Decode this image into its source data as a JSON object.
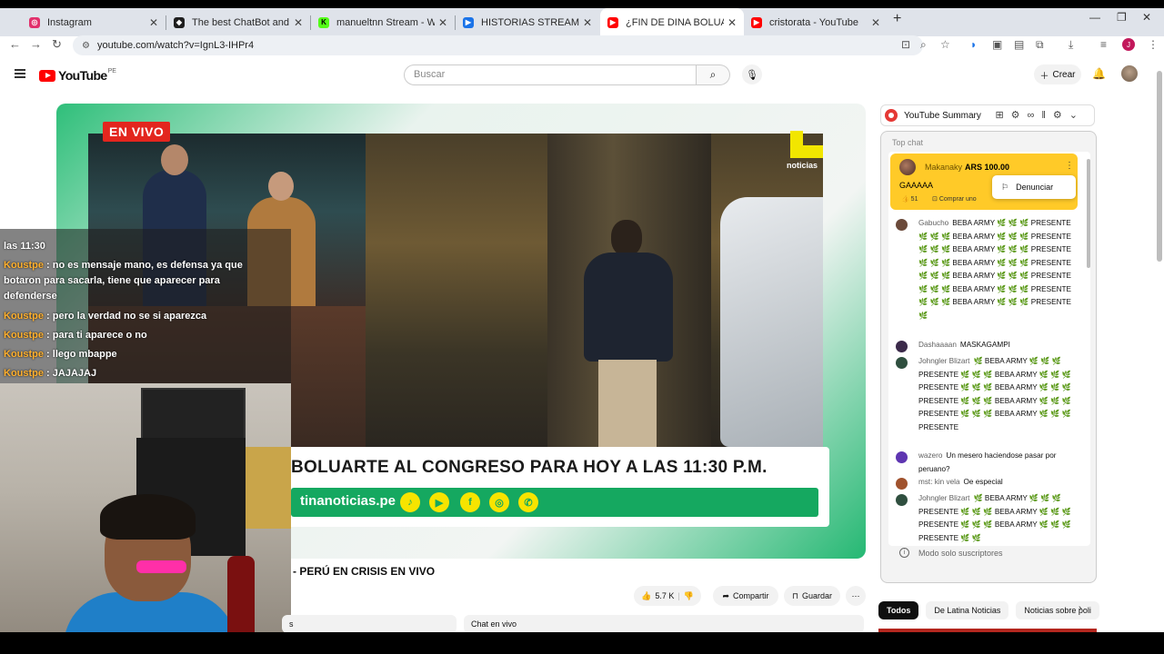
{
  "tabs": [
    {
      "label": "Instagram",
      "icon": "instagram-icon",
      "color": "#e1306c"
    },
    {
      "label": "The best ChatBot and Widgets",
      "icon": "streamelements-icon",
      "color": "#1f1f1f"
    },
    {
      "label": "manueltnn Stream - Watch Live",
      "icon": "kick-icon",
      "color": "#53fc18"
    },
    {
      "label": "HISTORIAS STREAM - Tu histor",
      "icon": "meet-icon",
      "color": "#1a73e8"
    },
    {
      "label": "¿FIN DE DINA BOLUARTE? - PE",
      "icon": "youtube-icon",
      "color": "#ff0000"
    },
    {
      "label": "cristorata - YouTube",
      "icon": "youtube-icon",
      "color": "#ff0000"
    }
  ],
  "browser": {
    "url": "youtube.com/watch?v=IgnL3-IHPr4",
    "new_tab": "+",
    "profile_initial": "J"
  },
  "youtube": {
    "logo_text": "YouTube",
    "country": "PE",
    "search_placeholder": "Buscar",
    "create_label": "Crear"
  },
  "player": {
    "live_badge": "EN VIVO",
    "brand_text": "noticias",
    "headline": "BOLUARTE AL CONGRESO PARA HOY A LAS 11:30 P.M.",
    "site": "tinanoticias.pe"
  },
  "overlay_chat": [
    {
      "user": "",
      "text": "las 11:30"
    },
    {
      "user": "Koustpe",
      "text": "no es mensaje mano, es defensa ya que botaron para sacarla, tiene que aparecer para defenderse"
    },
    {
      "user": "Koustpe",
      "text": "pero la verdad no se si aparezca"
    },
    {
      "user": "Koustpe",
      "text": "para ti aparece o no"
    },
    {
      "user": "Koustpe",
      "text": "llego mbappe"
    },
    {
      "user": "Koustpe",
      "text": "JAJAJAJ"
    }
  ],
  "video": {
    "title": "- PERÚ EN CRISIS EN VIVO",
    "likes": "5.7 K",
    "share": "Compartir",
    "save": "Guardar",
    "chat_tab": "Chat en vivo",
    "desc_tab": "s"
  },
  "summary": {
    "label": "YouTube Summary"
  },
  "chat": {
    "header": "Top chat",
    "superchat": {
      "user": "Makanaky",
      "amount": "ARS 100.00",
      "message": "GAAAAA",
      "likes": "51",
      "buy": "Comprar uno"
    },
    "report_label": "Denunciar",
    "messages": [
      {
        "user": "Gabucho",
        "text": "BEBA ARMY 🌿 🌿 🌿 PRESENTE 🌿 🌿 🌿 BEBA ARMY 🌿 🌿 🌿 PRESENTE 🌿 🌿 🌿 BEBA ARMY 🌿 🌿 🌿 PRESENTE 🌿 🌿 🌿 BEBA ARMY 🌿 🌿 🌿 PRESENTE 🌿 🌿 🌿 BEBA ARMY 🌿 🌿 🌿 PRESENTE 🌿 🌿 🌿 BEBA ARMY 🌿 🌿 🌿 PRESENTE 🌿 🌿 🌿 BEBA ARMY 🌿 🌿 🌿 PRESENTE 🌿",
        "color": "#6b4a3a"
      },
      {
        "user": "Dashaaaan",
        "text": "MASKAGAMPI",
        "color": "#3b2a4a"
      },
      {
        "user": "Johngler Blizart",
        "text": "🌿 BEBA ARMY 🌿 🌿 🌿 PRESENTE 🌿 🌿 🌿 BEBA ARMY 🌿 🌿 🌿 PRESENTE 🌿 🌿 🌿 BEBA ARMY 🌿 🌿 🌿 PRESENTE 🌿 🌿 🌿 BEBA ARMY 🌿 🌿 🌿 PRESENTE 🌿 🌿 🌿 BEBA ARMY 🌿 🌿 🌿 PRESENTE",
        "color": "#2f4f3f"
      },
      {
        "user": "wazero",
        "text": "Un mesero haciendose pasar por peruano?",
        "color": "#5e35b1"
      },
      {
        "user": "mst: kin vela",
        "text": "Oe especial",
        "color": "#a0522d"
      },
      {
        "user": "Johngler Blizart",
        "text": "🌿 BEBA ARMY 🌿 🌿 🌿 PRESENTE 🌿 🌿 🌿 BEBA ARMY 🌿 🌿 🌿 PRESENTE 🌿 🌿 🌿 BEBA ARMY 🌿 🌿 🌿 PRESENTE 🌿 🌿",
        "color": "#2f4f3f"
      }
    ],
    "mode_text": "Modo solo suscriptores"
  },
  "chips": [
    "Todos",
    "De Latina Noticias",
    "Noticias sobre poli"
  ]
}
